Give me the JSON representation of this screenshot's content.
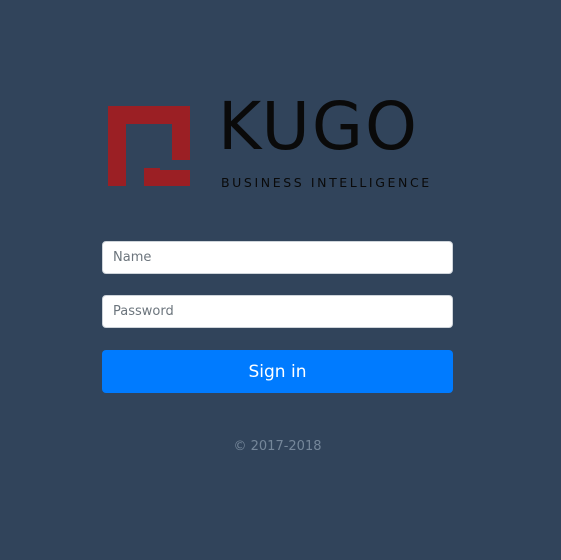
{
  "brand": {
    "name": "KUGO",
    "tagline": "BUSINESS INTELLIGENCE",
    "mark_color": "#9b1f24",
    "text_color": "#0a0a0a"
  },
  "form": {
    "name_placeholder": "Name",
    "name_value": "",
    "password_placeholder": "Password",
    "password_value": "",
    "signin_label": "Sign in",
    "signin_color": "#007bff"
  },
  "footer": {
    "copyright": "© 2017-2018"
  },
  "theme": {
    "background": "#31445b"
  }
}
